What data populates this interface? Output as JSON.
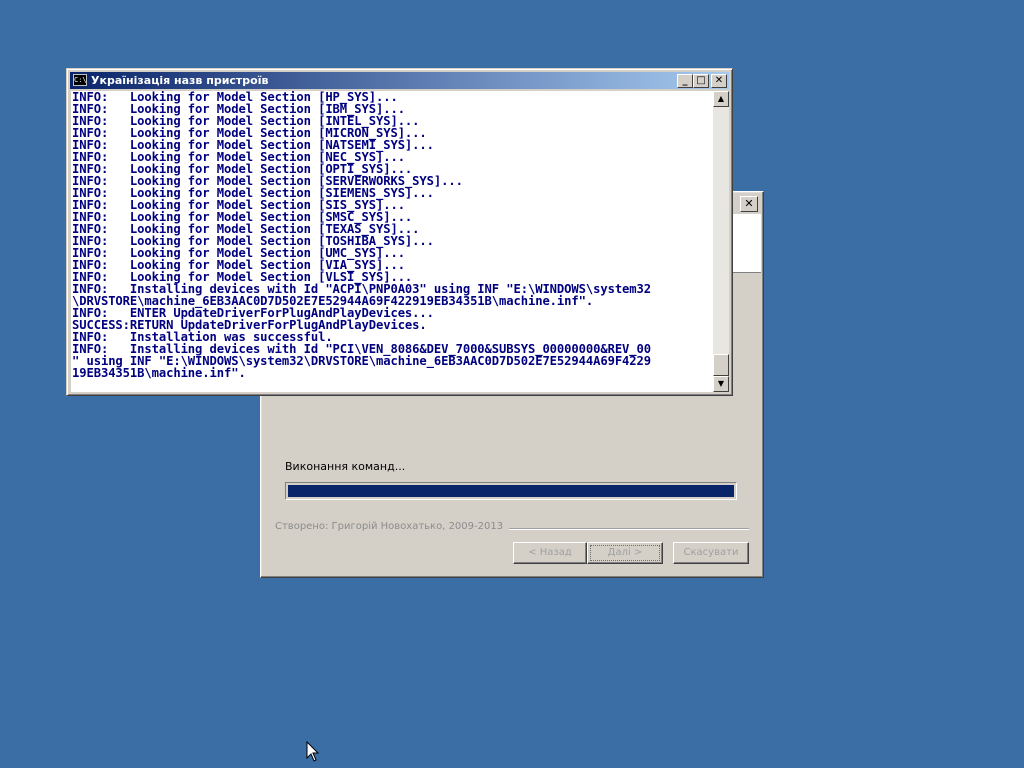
{
  "console": {
    "title": "Українізація назв пристроїв",
    "icon": "C:\\",
    "minimize_glyph": "_",
    "maximize_glyph": "□",
    "close_glyph": "✕",
    "scroll_up_glyph": "▲",
    "scroll_down_glyph": "▼",
    "lines": [
      "INFO:   Looking for Model Section [HP_SYS]...",
      "INFO:   Looking for Model Section [IBM_SYS]...",
      "INFO:   Looking for Model Section [INTEL_SYS]...",
      "INFO:   Looking for Model Section [MICRON_SYS]...",
      "INFO:   Looking for Model Section [NATSEMI_SYS]...",
      "INFO:   Looking for Model Section [NEC_SYS]...",
      "INFO:   Looking for Model Section [OPTI_SYS]...",
      "INFO:   Looking for Model Section [SERVERWORKS_SYS]...",
      "INFO:   Looking for Model Section [SIEMENS_SYS]...",
      "INFO:   Looking for Model Section [SIS_SYS]...",
      "INFO:   Looking for Model Section [SMSC_SYS]...",
      "INFO:   Looking for Model Section [TEXAS_SYS]...",
      "INFO:   Looking for Model Section [TOSHIBA_SYS]...",
      "INFO:   Looking for Model Section [UMC_SYS]...",
      "INFO:   Looking for Model Section [VIA_SYS]...",
      "INFO:   Looking for Model Section [VLSI_SYS]...",
      "INFO:   Installing devices with Id \"ACPI\\PNP0A03\" using INF \"E:\\WINDOWS\\system32",
      "\\DRVSTORE\\machine_6EB3AAC0D7D502E7E52944A69F422919EB34351B\\machine.inf\".",
      "INFO:   ENTER UpdateDriverForPlugAndPlayDevices...",
      "SUCCESS:RETURN UpdateDriverForPlugAndPlayDevices.",
      "INFO:   Installation was successful.",
      "INFO:   Installing devices with Id \"PCI\\VEN_8086&DEV_7000&SUBSYS_00000000&REV_00",
      "\" using INF \"E:\\WINDOWS\\system32\\DRVSTORE\\machine_6EB3AAC0D7D502E7E52944A69F4229",
      "19EB34351B\\machine.inf\"."
    ]
  },
  "wizard": {
    "close_glyph": "✕",
    "status_text": "Виконання команд...",
    "progress_fraction": 1.0,
    "credit": "Створено: Григорій Новохатько, 2009-2013",
    "back_label": "< Назад",
    "next_label": "Далі >",
    "cancel_label": "Скасувати"
  },
  "colors": {
    "desktop": "#3a6ea5",
    "console_text": "#000080",
    "progress_fill": "#0a246a",
    "titlebar_active": "#0a246a"
  }
}
